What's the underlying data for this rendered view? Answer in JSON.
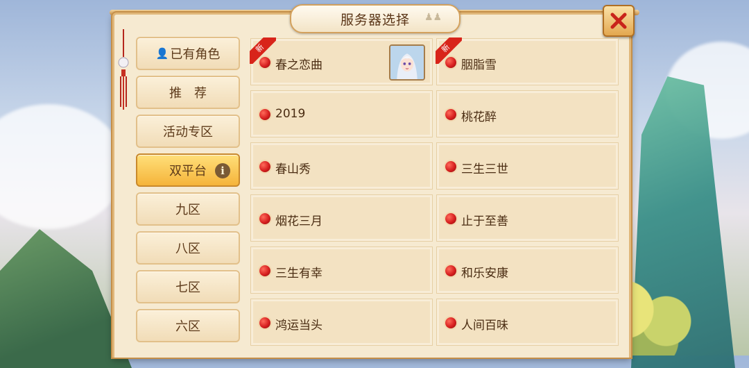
{
  "window": {
    "title": "服务器选择"
  },
  "icons": {
    "close": "close-x-icon",
    "person": "person-icon",
    "info": "info-icon",
    "status_dot": "red-status-dot-icon"
  },
  "colors": {
    "active_category": "#f5b43a",
    "status_dot": "#d61f1f",
    "new_badge": "#d8241a"
  },
  "categories": [
    {
      "label": "已有角色",
      "active": false,
      "has_person_icon": true
    },
    {
      "label": "推　荐",
      "active": false
    },
    {
      "label": "活动专区",
      "active": false
    },
    {
      "label": "双平台",
      "active": true,
      "has_info_icon": true,
      "info_text": "i"
    },
    {
      "label": "九区",
      "active": false
    },
    {
      "label": "八区",
      "active": false
    },
    {
      "label": "七区",
      "active": false
    },
    {
      "label": "六区",
      "active": false
    }
  ],
  "servers": [
    {
      "name": "春之恋曲",
      "new": true,
      "new_label": "新",
      "has_avatar": true
    },
    {
      "name": "胭脂雪",
      "new": true,
      "new_label": "新"
    },
    {
      "name": "2019"
    },
    {
      "name": "桃花醉"
    },
    {
      "name": "春山秀"
    },
    {
      "name": "三生三世"
    },
    {
      "name": "烟花三月"
    },
    {
      "name": "止于至善"
    },
    {
      "name": "三生有幸"
    },
    {
      "name": "和乐安康"
    },
    {
      "name": "鸿运当头"
    },
    {
      "name": "人间百味"
    }
  ]
}
